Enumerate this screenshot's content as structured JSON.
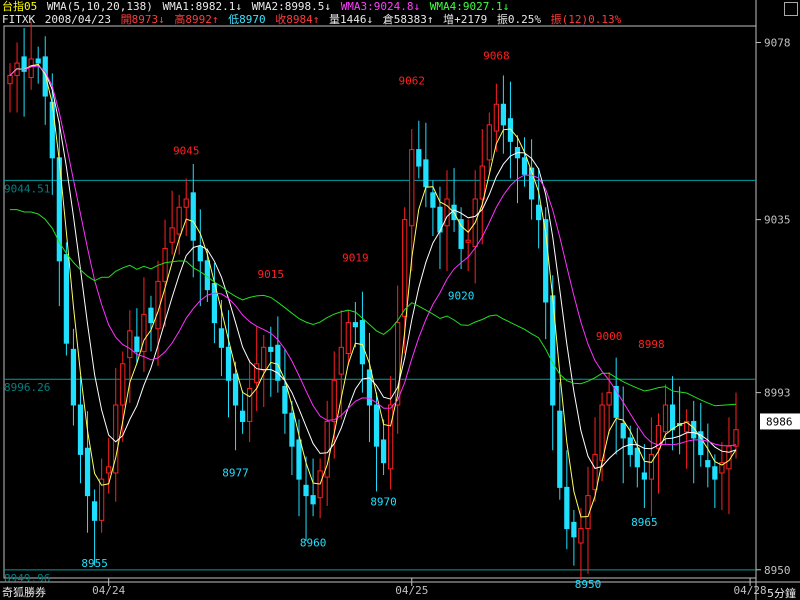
{
  "header": {
    "symbol": "台指05",
    "wma_label": "WMA(5,10,20,138)",
    "wma1": "WMA1:8982.1↓",
    "wma2": "WMA2:8998.5↓",
    "wma3": "WMA3:9024.8↓",
    "wma4": "WMA4:9027.1↓",
    "code": "FITXK",
    "date": "2008/04/23",
    "open": "開8973↓",
    "high": "高8992↑",
    "low": "低8970",
    "close": "收8984↑",
    "volume": "量1446↓",
    "oi": "倉58383↑",
    "change": "增+2179",
    "amplitude": "振0.25%",
    "amp12": "振(12)0.13%"
  },
  "footer": {
    "brand": "奇狐勝券",
    "unit": "5分鐘"
  },
  "colors": {
    "up": "#ff2020",
    "down": "#20e0ff",
    "wma1": "#ffff60",
    "wma2": "#ffffff",
    "wma3": "#ff30ff",
    "wma4": "#20e020",
    "hline": "#00a0a0",
    "axis": "#c0c0c0"
  },
  "chart_data": {
    "type": "candlestick",
    "ylim": [
      8948,
      9082
    ],
    "yticks": [
      9078,
      9035,
      8993,
      8950
    ],
    "hlines": [
      {
        "value": 9044.51,
        "label": "9044.51"
      },
      {
        "value": 8996.26,
        "label": "8996.26"
      },
      {
        "value": 8949.96,
        "label": "8949.96"
      }
    ],
    "last_price": "8986",
    "xticks": [
      {
        "index": 14,
        "label": "04/24"
      },
      {
        "index": 57,
        "label": "04/25"
      },
      {
        "index": 105,
        "label": "04/28"
      }
    ],
    "annotations": [
      {
        "index": 12,
        "value": 8955,
        "label": "8955",
        "kind": "low"
      },
      {
        "index": 25,
        "value": 9045,
        "label": "9045",
        "kind": "high"
      },
      {
        "index": 32,
        "value": 8977,
        "label": "8977",
        "kind": "low"
      },
      {
        "index": 37,
        "value": 9015,
        "label": "9015",
        "kind": "high"
      },
      {
        "index": 43,
        "value": 8960,
        "label": "8960",
        "kind": "low"
      },
      {
        "index": 49,
        "value": 9019,
        "label": "9019",
        "kind": "high"
      },
      {
        "index": 53,
        "value": 8970,
        "label": "8970",
        "kind": "low"
      },
      {
        "index": 57,
        "value": 9062,
        "label": "9062",
        "kind": "high"
      },
      {
        "index": 64,
        "value": 9020,
        "label": "9020",
        "kind": "low"
      },
      {
        "index": 69,
        "value": 9068,
        "label": "9068",
        "kind": "high"
      },
      {
        "index": 82,
        "value": 8950,
        "label": "8950",
        "kind": "low"
      },
      {
        "index": 85,
        "value": 9000,
        "label": "9000",
        "kind": "high"
      },
      {
        "index": 91,
        "value": 8998,
        "label": "8998",
        "kind": "high"
      },
      {
        "index": 90,
        "value": 8965,
        "label": "8965",
        "kind": "low"
      }
    ],
    "closes": [
      9070,
      9073,
      9071,
      9074,
      9073,
      9065,
      9050,
      9025,
      9005,
      8990,
      8978,
      8968,
      8962,
      8972,
      8975,
      8990,
      9000,
      9008,
      9003,
      9012,
      9010,
      9020,
      9028,
      9033,
      9038,
      9040,
      9030,
      9025,
      9018,
      9010,
      9004,
      8996,
      8990,
      8986,
      8994,
      9000,
      9004,
      9003,
      8996,
      8988,
      8980,
      8972,
      8968,
      8966,
      8974,
      8986,
      8996,
      9004,
      9010,
      9009,
      9000,
      8990,
      8980,
      8976,
      8990,
      9010,
      9035,
      9052,
      9048,
      9043,
      9038,
      9032,
      9040,
      9035,
      9028,
      9030,
      9040,
      9048,
      9058,
      9063,
      9058,
      9054,
      9050,
      9046,
      9040,
      9035,
      9015,
      8990,
      8970,
      8960,
      8958,
      8960,
      8968,
      8978,
      8990,
      8993,
      8987,
      8982,
      8978,
      8975,
      8972,
      8978,
      8985,
      8990,
      8984,
      8985,
      8986,
      8982,
      8978,
      8975,
      8972,
      8976,
      8980,
      8984
    ],
    "wma_periods": [
      5,
      10,
      20,
      138
    ],
    "wma4_endpoints": [
      9033,
      8991
    ]
  }
}
